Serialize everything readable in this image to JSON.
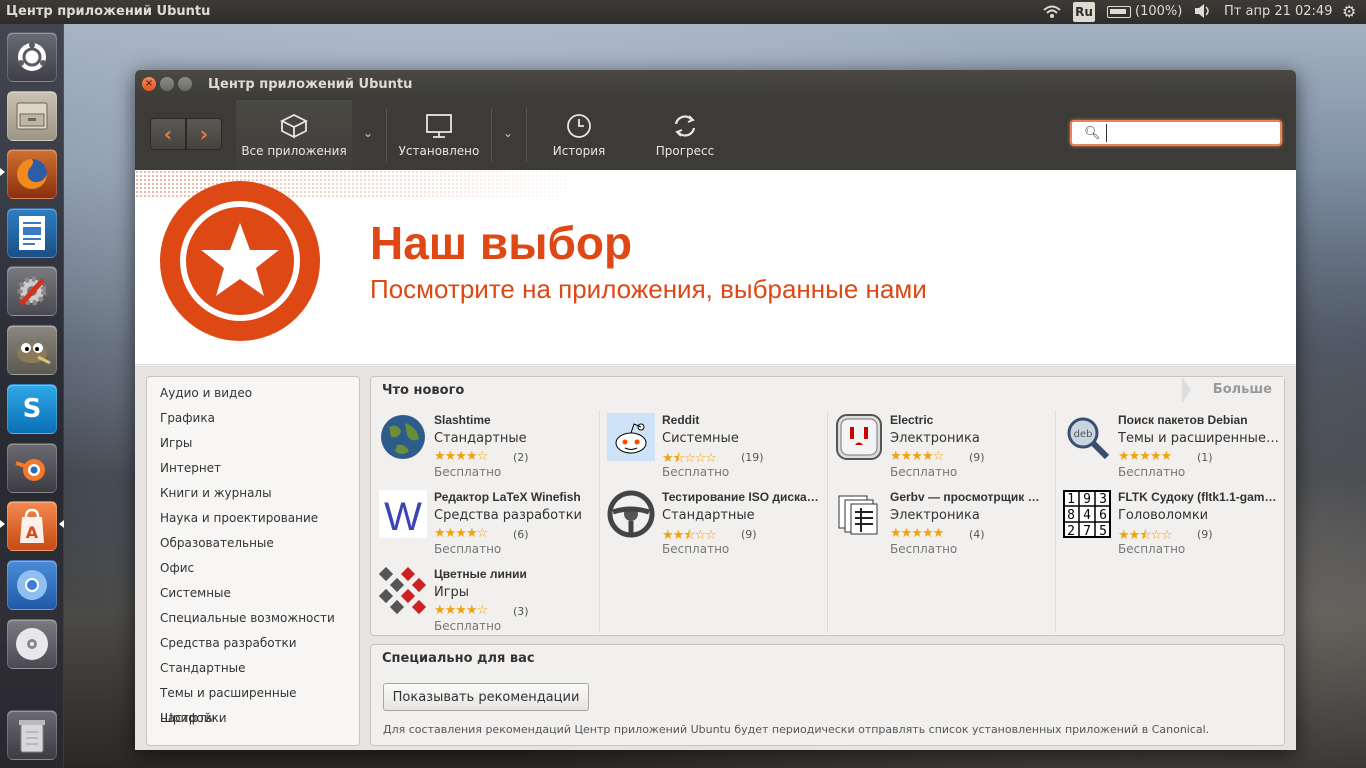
{
  "top_panel": {
    "app_title": "Центр приложений Ubuntu",
    "keyboard": "Ru",
    "battery": "(100%)",
    "clock": "Пт апр 21 02:49"
  },
  "launcher": {
    "items": [
      "ubuntu-dash",
      "files",
      "firefox",
      "writer",
      "system-settings",
      "gimp",
      "skype",
      "blender",
      "software-center",
      "chromium",
      "dvd",
      "trash"
    ]
  },
  "window": {
    "title": "Центр приложений Ubuntu"
  },
  "toolbar": {
    "all_apps": "Все приложения",
    "installed": "Установлено",
    "history": "История",
    "progress": "Прогресс",
    "search_value": ""
  },
  "banner": {
    "title": "Наш выбор",
    "subtitle": "Посмотрите на приложения, выбранные нами"
  },
  "categories": [
    "Аудио и видео",
    "Графика",
    "Игры",
    "Интернет",
    "Книги и журналы",
    "Наука и проектирование",
    "Образовательные",
    "Офис",
    "Системные",
    "Специальные возможности",
    "Средства разработки",
    "Стандартные",
    "Темы и расширенные настройки",
    "Шрифты"
  ],
  "whats_new": {
    "title": "Что нового",
    "more": "Больше",
    "apps": [
      {
        "name": "Slashtime",
        "category": "Стандартные",
        "stars": 4,
        "count": "(2)",
        "price": "Бесплатно",
        "icon": "globe-icon"
      },
      {
        "name": "Reddit",
        "category": "Системные",
        "stars": 1.5,
        "count": "(19)",
        "price": "Бесплатно",
        "icon": "reddit-icon"
      },
      {
        "name": "Electric",
        "category": "Электроника",
        "stars": 4,
        "count": "(9)",
        "price": "Бесплатно",
        "icon": "electric-socket-icon"
      },
      {
        "name": "Поиск пакетов Debian",
        "category": "Темы и расширенные н…",
        "stars": 5,
        "count": "(1)",
        "price": "Бесплатно",
        "icon": "debian-search-icon"
      },
      {
        "name": "Редактор LaTeX Winefish",
        "category": "Средства разработки",
        "stars": 4,
        "count": "(6)",
        "price": "Бесплатно",
        "icon": "winefish-icon"
      },
      {
        "name": "Тестирование ISO диска …",
        "category": "Стандартные",
        "stars": 2.5,
        "count": "(9)",
        "price": "Бесплатно",
        "icon": "steering-wheel-icon"
      },
      {
        "name": "Gerbv — просмотрщик …",
        "category": "Электроника",
        "stars": 5,
        "count": "(4)",
        "price": "Бесплатно",
        "icon": "gerbv-icon"
      },
      {
        "name": "FLTK Судоку (fltk1.1-gam…",
        "category": "Головоломки",
        "stars": 2.5,
        "count": "(9)",
        "price": "Бесплатно",
        "icon": "sudoku-icon"
      },
      {
        "name": "Цветные линии",
        "category": "Игры",
        "stars": 4,
        "count": "(3)",
        "price": "Бесплатно",
        "icon": "color-lines-icon"
      }
    ]
  },
  "for_you": {
    "title": "Специально для вас",
    "button": "Показывать рекомендации",
    "note": "Для составления рекомендаций Центр приложений Ubuntu будет периодически отправлять список установленных приложений в Canonical.",
    "sudoku_digits": [
      "1",
      "9",
      "3",
      "8",
      "4",
      "6",
      "2",
      "7",
      "5"
    ]
  },
  "colors": {
    "accent": "#dd4814",
    "panel": "#3c3b37",
    "stars": "#f0a30a"
  }
}
